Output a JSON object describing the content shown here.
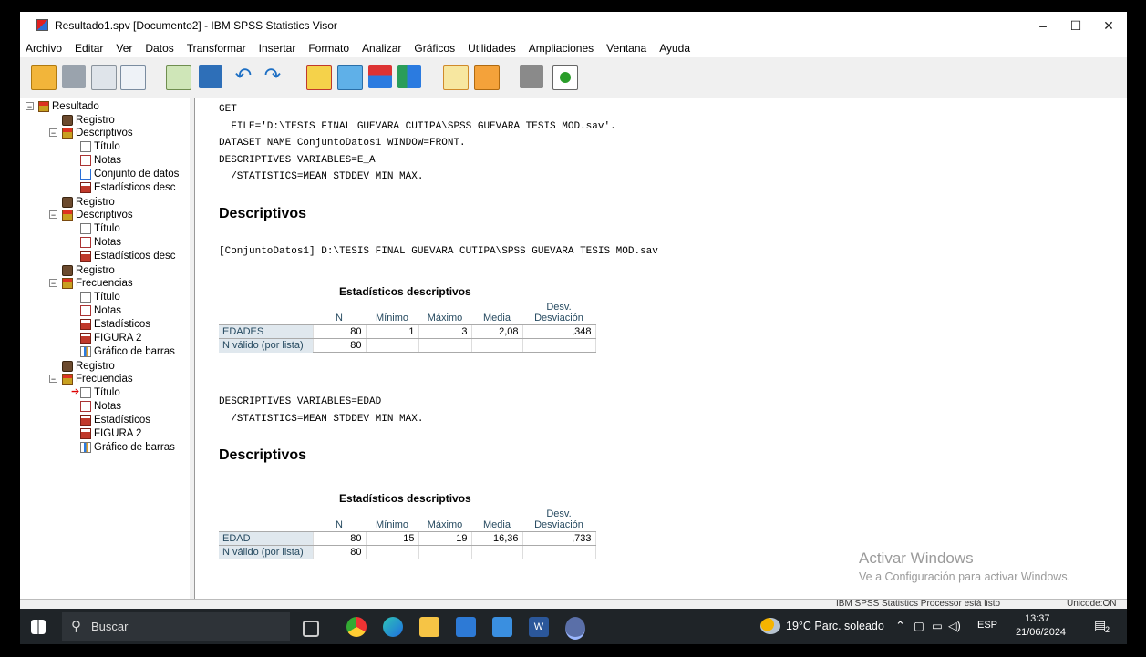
{
  "window": {
    "title": "Resultado1.spv [Documento2] - IBM SPSS Statistics Visor",
    "minimize_glyph": "–",
    "maximize_glyph": "☐",
    "close_glyph": "✕"
  },
  "menu": [
    "Archivo",
    "Editar",
    "Ver",
    "Datos",
    "Transformar",
    "Insertar",
    "Formato",
    "Analizar",
    "Gráficos",
    "Utilidades",
    "Ampliaciones",
    "Ventana",
    "Ayuda"
  ],
  "toolbar_icons": [
    "open-icon",
    "save-icon",
    "print-icon",
    "print-preview-icon",
    "export-icon",
    "recall-dialog-icon",
    "undo-icon",
    "redo-icon",
    "goto-data-icon",
    "goto-case-icon",
    "goto-variable-icon",
    "variables-icon",
    "show-all-icon",
    "designate-window-icon",
    "insert-output-icon",
    "insert-heading-icon",
    "create-syntax-icon"
  ],
  "tree": {
    "root": "Resultado",
    "items": [
      {
        "label": "Registro",
        "icon": "log-icon"
      },
      {
        "label": "Descriptivos",
        "icon": "book-icon"
      },
      {
        "label": "Título",
        "icon": "title-icon"
      },
      {
        "label": "Notas",
        "icon": "notes-icon"
      },
      {
        "label": "Conjunto de datos",
        "icon": "dataset-icon"
      },
      {
        "label": "Estadísticos desc",
        "icon": "table-icon"
      },
      {
        "label": "Registro",
        "icon": "log-icon"
      },
      {
        "label": "Descriptivos",
        "icon": "book-icon"
      },
      {
        "label": "Título",
        "icon": "title-icon"
      },
      {
        "label": "Notas",
        "icon": "notes-icon"
      },
      {
        "label": "Estadísticos desc",
        "icon": "table-icon"
      },
      {
        "label": "Registro",
        "icon": "log-icon"
      },
      {
        "label": "Frecuencias",
        "icon": "book-icon"
      },
      {
        "label": "Título",
        "icon": "title-icon"
      },
      {
        "label": "Notas",
        "icon": "notes-icon"
      },
      {
        "label": "Estadísticos",
        "icon": "table-icon"
      },
      {
        "label": "FIGURA 2",
        "icon": "table-icon"
      },
      {
        "label": "Gráfico de barras",
        "icon": "chart-icon"
      },
      {
        "label": "Registro",
        "icon": "log-icon"
      },
      {
        "label": "Frecuencias",
        "icon": "book-icon"
      },
      {
        "label": "Título",
        "icon": "title-icon"
      },
      {
        "label": "Notas",
        "icon": "notes-icon"
      },
      {
        "label": "Estadísticos",
        "icon": "table-icon"
      },
      {
        "label": "FIGURA 2",
        "icon": "table-icon"
      },
      {
        "label": "Gráfico de barras",
        "icon": "chart-icon"
      }
    ]
  },
  "content": {
    "syntax1": [
      "GET",
      "  FILE='D:\\TESIS FINAL GUEVARA CUTIPA\\SPSS GUEVARA TESIS MOD.sav'.",
      "DATASET NAME ConjuntoDatos1 WINDOW=FRONT.",
      "DESCRIPTIVES VARIABLES=E_A",
      "  /STATISTICS=MEAN STDDEV MIN MAX."
    ],
    "heading1": "Descriptivos",
    "dataset_line": "[ConjuntoDatos1] D:\\TESIS FINAL GUEVARA CUTIPA\\SPSS GUEVARA TESIS MOD.sav",
    "table1": {
      "title": "Estadísticos descriptivos",
      "headers": [
        "N",
        "Mínimo",
        "Máximo",
        "Media",
        "Desv. Desviación"
      ],
      "rows": [
        {
          "label": "EDADES",
          "values": [
            "80",
            "1",
            "3",
            "2,08",
            ",348"
          ]
        },
        {
          "label": "N válido (por lista)",
          "values": [
            "80",
            "",
            "",
            "",
            ""
          ]
        }
      ]
    },
    "syntax2": [
      "DESCRIPTIVES VARIABLES=EDAD",
      "  /STATISTICS=MEAN STDDEV MIN MAX."
    ],
    "heading2": "Descriptivos",
    "table2": {
      "title": "Estadísticos descriptivos",
      "headers": [
        "N",
        "Mínimo",
        "Máximo",
        "Media",
        "Desv. Desviación"
      ],
      "rows": [
        {
          "label": "EDAD",
          "values": [
            "80",
            "15",
            "19",
            "16,36",
            ",733"
          ]
        },
        {
          "label": "N válido (por lista)",
          "values": [
            "80",
            "",
            "",
            "",
            ""
          ]
        }
      ]
    }
  },
  "watermark": {
    "line1": "Activar Windows",
    "line2": "Ve a Configuración para activar Windows."
  },
  "status": {
    "processor": "IBM SPSS Statistics Processor está listo",
    "unicode": "Unicode:ON"
  },
  "taskbar": {
    "search_placeholder": "Buscar",
    "weather": "19°C  Parc. soleado",
    "language": "ESP",
    "time": "13:37",
    "date": "21/06/2024",
    "notifications": "2"
  }
}
